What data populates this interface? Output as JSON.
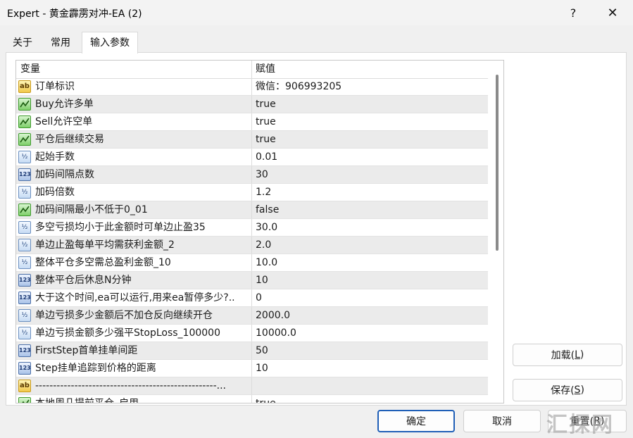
{
  "window": {
    "title": "Expert - 黄金霹雳对冲-EA (2)",
    "help_label": "?",
    "close_label": "✕"
  },
  "tabs": [
    {
      "label": "关于"
    },
    {
      "label": "常用"
    },
    {
      "label": "输入参数",
      "active": true
    }
  ],
  "grid": {
    "headers": {
      "name": "变量",
      "value": "赋值"
    },
    "rows": [
      {
        "icon": "ab",
        "name": "订单标识",
        "value": "微信：906993205"
      },
      {
        "icon": "bool",
        "name": "Buy允许多单",
        "value": "true"
      },
      {
        "icon": "bool",
        "name": "Sell允许空单",
        "value": "true"
      },
      {
        "icon": "bool",
        "name": "平仓后继续交易",
        "value": "true"
      },
      {
        "icon": "half",
        "name": "起始手数",
        "value": "0.01"
      },
      {
        "icon": "123",
        "name": "加码间隔点数",
        "value": "30"
      },
      {
        "icon": "half",
        "name": "加码倍数",
        "value": "1.2"
      },
      {
        "icon": "bool",
        "name": "加码间隔最小不低于0_01",
        "value": "false"
      },
      {
        "icon": "half",
        "name": "多空亏损均小于此金额时可单边止盈35",
        "value": "30.0"
      },
      {
        "icon": "half",
        "name": "单边止盈每单平均需获利金额_2",
        "value": "2.0"
      },
      {
        "icon": "half",
        "name": "整体平仓多空需总盈利金额_10",
        "value": "10.0"
      },
      {
        "icon": "123",
        "name": "整体平仓后休息N分钟",
        "value": "10"
      },
      {
        "icon": "123",
        "name": "大于这个时间,ea可以运行,用来ea暂停多少?..",
        "value": "0"
      },
      {
        "icon": "half",
        "name": "单边亏损多少金额后不加仓反向继续开仓",
        "value": "2000.0"
      },
      {
        "icon": "half",
        "name": "单边亏损金额多少强平StopLoss_100000",
        "value": "10000.0"
      },
      {
        "icon": "123",
        "name": "FirstStep首单挂单间距",
        "value": "50"
      },
      {
        "icon": "123",
        "name": "Step挂单追踪到价格的距离",
        "value": "10"
      },
      {
        "icon": "ab",
        "name": "---------------------------------------------------...",
        "value": ""
      },
      {
        "icon": "bool",
        "name": "本地周几提前平仓_启用",
        "value": "true"
      }
    ]
  },
  "buttons": {
    "load": {
      "text": "加载(",
      "key": "L",
      "end": ")"
    },
    "save": {
      "text": "保存(",
      "key": "S",
      "end": ")"
    },
    "ok": "确定",
    "cancel": "取消",
    "reset": {
      "text": "重置(",
      "key": "R",
      "end": ")"
    }
  },
  "watermark": "汇探网"
}
